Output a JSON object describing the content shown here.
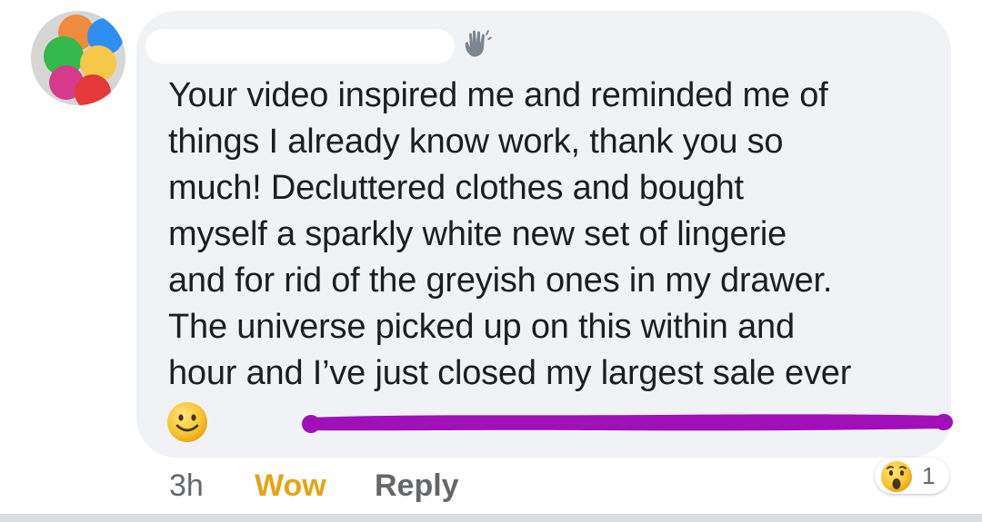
{
  "comment": {
    "lines": [
      "Your video inspired me and reminded me of",
      "things I already know work, thank you so",
      "much! Decluttered clothes and bought",
      "myself a sparkly white new set of lingerie",
      "and for rid of the greyish ones in my drawer.",
      "The universe picked up on this within and",
      "hour and I’ve just closed my largest sale ever"
    ],
    "emoji": "slightly-smiling-face-icon"
  },
  "footer": {
    "time": "3h",
    "reaction_label": "Wow",
    "reply_label": "Reply",
    "reaction_icon": "wow-face-icon",
    "reaction_count": "1"
  },
  "colors": {
    "bubble": "#f0f2f5",
    "wow_accent": "#e4a514",
    "muted_text": "#65676b",
    "highlight_stroke": "#a010b8"
  }
}
